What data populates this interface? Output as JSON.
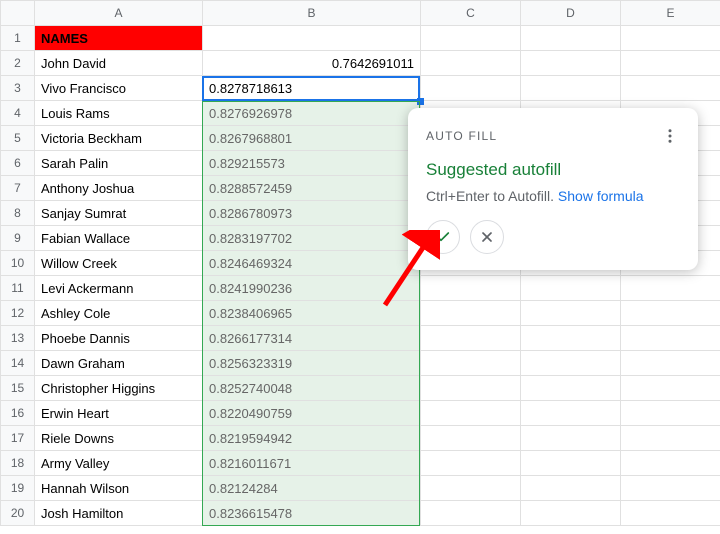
{
  "columns": [
    "A",
    "B",
    "C",
    "D",
    "E"
  ],
  "rows": [
    1,
    2,
    3,
    4,
    5,
    6,
    7,
    8,
    9,
    10,
    11,
    12,
    13,
    14,
    15,
    16,
    17,
    18,
    19,
    20
  ],
  "headerCell": "NAMES",
  "data": {
    "names": [
      "John David",
      "Vivo Francisco",
      "Louis Rams",
      "Victoria Beckham",
      "Sarah Palin",
      "Anthony Joshua",
      "Sanjay Sumrat",
      "Fabian Wallace",
      "Willow Creek",
      "Levi Ackermann",
      "Ashley Cole",
      "Phoebe Dannis",
      "Dawn Graham",
      "Christopher Higgins",
      "Erwin Heart",
      "Riele Downs",
      "Army Valley",
      "Hannah Wilson",
      "Josh Hamilton"
    ],
    "b_top": "0.7642691011",
    "b_sel": "0.8278718613",
    "b_fill": [
      "0.8276926978",
      "0.8267968801",
      "0.829215573",
      "0.8288572459",
      "0.8286780973",
      "0.8283197702",
      "0.8246469324",
      "0.8241990236",
      "0.8238406965",
      "0.8266177314",
      "0.8256323319",
      "0.8252740048",
      "0.8220490759",
      "0.8219594942",
      "0.8216011671",
      "0.82124284",
      "0.8236615478"
    ]
  },
  "popup": {
    "title": "AUTO FILL",
    "heading": "Suggested autofill",
    "hint_prefix": "Ctrl+Enter to Autofill. ",
    "hint_link": "Show formula"
  }
}
